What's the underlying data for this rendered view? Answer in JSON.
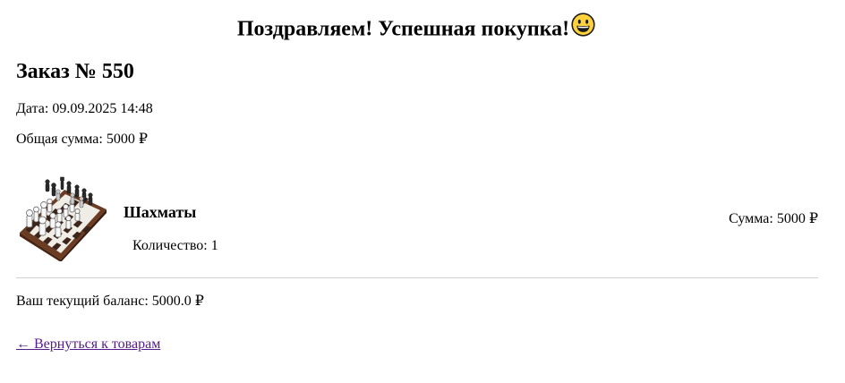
{
  "header": {
    "headline": "Поздравляем! Успешная покупка!",
    "emoji_icon": "grinning-face-icon"
  },
  "order": {
    "title": "Заказ № 550",
    "date_label": "Дата:",
    "date_value": "09.09.2025 14:48",
    "total_label": "Общая сумма:",
    "total_value": "5000 ₽"
  },
  "items": [
    {
      "name": "Шахматы",
      "image_icon": "chess-board-image",
      "quantity_label": "Количество:",
      "quantity": "1",
      "sum_label": "Сумма:",
      "sum_value": "5000 ₽"
    }
  ],
  "balance": {
    "label": "Ваш текущий баланс:",
    "value": "5000.0 ₽"
  },
  "nav": {
    "back_link": "← Вернуться к товарам"
  },
  "colors": {
    "link_visited": "#551a8b",
    "divider": "#d0d0d0",
    "emoji_face": "#ffd23c"
  }
}
